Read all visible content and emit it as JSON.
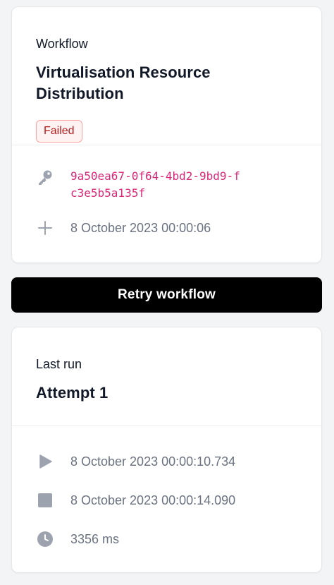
{
  "workflow": {
    "eyebrow": "Workflow",
    "title": "Virtualisation Resource Distribution",
    "status": "Failed",
    "id": "9a50ea67-0f64-4bd2-9bd9-fc3e5b5a135f",
    "created_at": "8 October 2023 00:00:06",
    "icons": {
      "id": "key-icon",
      "created": "plus-icon"
    },
    "colors": {
      "status_text": "#b91c1c",
      "status_bg": "#fef2f2",
      "status_border": "#fca5a5",
      "id_text": "#db2777"
    }
  },
  "actions": {
    "retry_label": "Retry workflow"
  },
  "last_run": {
    "eyebrow": "Last run",
    "title": "Attempt 1",
    "started_at": "8 October 2023 00:00:10.734",
    "finished_at": "8 October 2023 00:00:14.090",
    "duration": "3356 ms",
    "icons": {
      "started": "play-icon",
      "finished": "stop-icon",
      "duration": "clock-icon"
    }
  }
}
